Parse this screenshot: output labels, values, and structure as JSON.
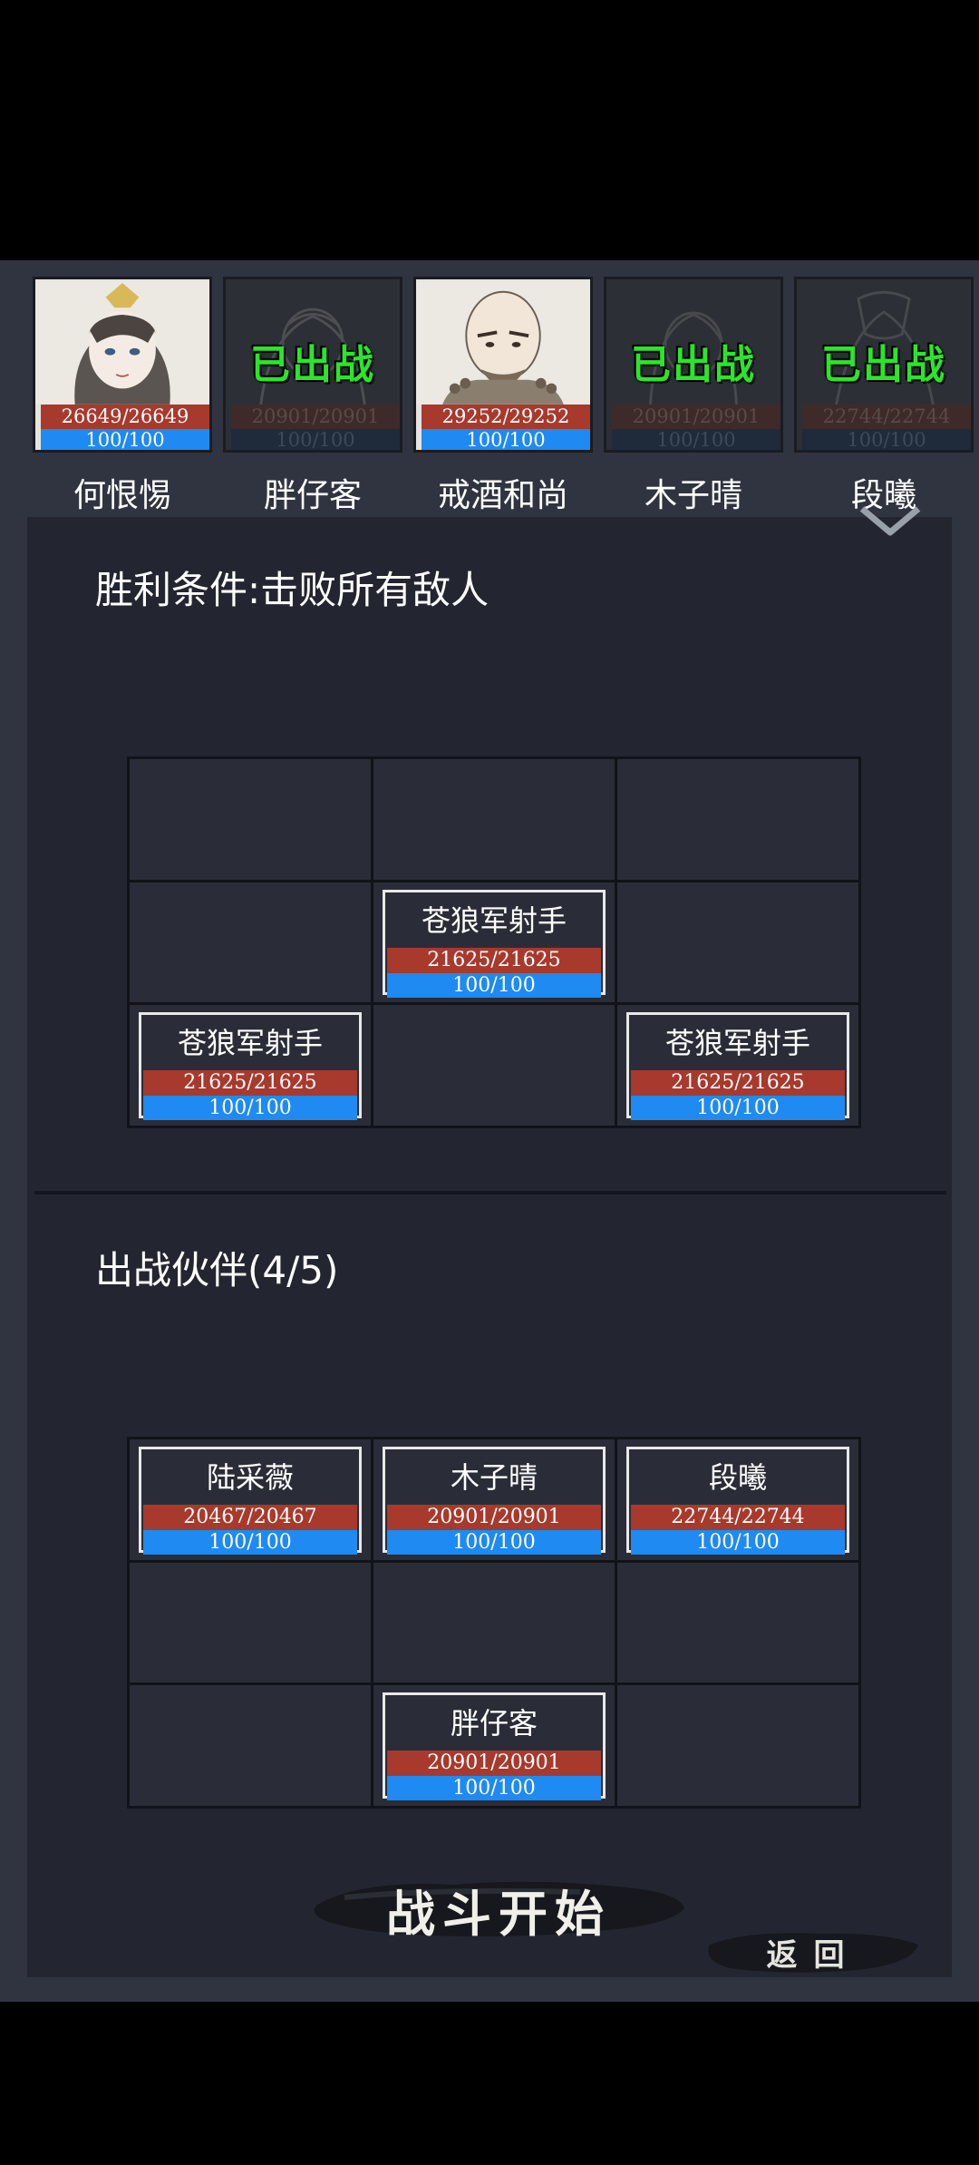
{
  "roster": [
    {
      "name": "何恨惕",
      "hp": "26649/26649",
      "mp": "100/100",
      "deployed": false
    },
    {
      "name": "胖仔客",
      "hp": "20901/20901",
      "mp": "100/100",
      "deployed": true,
      "tag": "已出战"
    },
    {
      "name": "戒酒和尚",
      "hp": "29252/29252",
      "mp": "100/100",
      "deployed": false
    },
    {
      "name": "木子晴",
      "hp": "20901/20901",
      "mp": "100/100",
      "deployed": true,
      "tag": "已出战"
    },
    {
      "name": "段曦",
      "hp": "22744/22744",
      "mp": "100/100",
      "deployed": true,
      "tag": "已出战"
    }
  ],
  "victory_condition": "胜利条件:击败所有敌人",
  "enemies": [
    {
      "name": "苍狼军射手",
      "hp": "21625/21625",
      "mp": "100/100"
    },
    {
      "name": "苍狼军射手",
      "hp": "21625/21625",
      "mp": "100/100"
    },
    {
      "name": "苍狼军射手",
      "hp": "21625/21625",
      "mp": "100/100"
    }
  ],
  "party_title": "出战伙伴(4/5)",
  "party": [
    {
      "name": "陆采薇",
      "hp": "20467/20467",
      "mp": "100/100"
    },
    {
      "name": "木子晴",
      "hp": "20901/20901",
      "mp": "100/100"
    },
    {
      "name": "段曦",
      "hp": "22744/22744",
      "mp": "100/100"
    },
    {
      "name": "胖仔客",
      "hp": "20901/20901",
      "mp": "100/100"
    }
  ],
  "start_button": "战斗开始",
  "back_button": "返回",
  "colors": {
    "hp": "#a8392d",
    "mp": "#1f8af1",
    "deployed_tag": "#2be52b",
    "panel": "#232630"
  },
  "icons": {
    "collapse": "chevron-down-icon"
  }
}
